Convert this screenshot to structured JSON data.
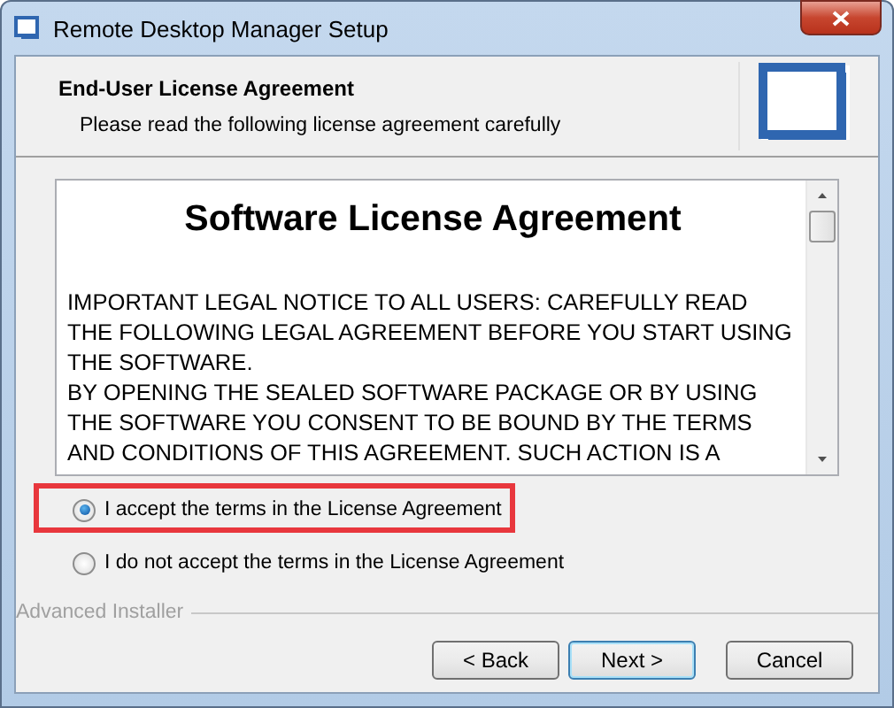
{
  "window": {
    "title": "Remote Desktop Manager Setup"
  },
  "header": {
    "title": "End-User License Agreement",
    "subtitle": "Please read the following license agreement carefully"
  },
  "license": {
    "heading": "Software License Agreement",
    "paragraphs": [
      [
        "IMPORTANT LEGAL NOTICE TO ALL USERS: CAREFULLY READ",
        "THE FOLLOWING LEGAL AGREEMENT BEFORE YOU START USING",
        "THE SOFTWARE."
      ],
      [
        "BY OPENING THE SEALED SOFTWARE PACKAGE OR BY USING",
        "THE SOFTWARE YOU CONSENT TO BE BOUND BY THE TERMS",
        "AND CONDITIONS OF THIS AGREEMENT. SUCH ACTION IS A"
      ]
    ]
  },
  "choices": [
    {
      "label": "I accept the terms in the License Agreement",
      "selected": true,
      "highlighted": true
    },
    {
      "label": "I do not accept the terms in the License Agreement",
      "selected": false,
      "highlighted": false
    }
  ],
  "brand": "Advanced Installer",
  "buttons": [
    {
      "label": "< Back",
      "default": false
    },
    {
      "label": "Next >",
      "default": true
    },
    {
      "label": "Cancel",
      "default": false
    }
  ]
}
